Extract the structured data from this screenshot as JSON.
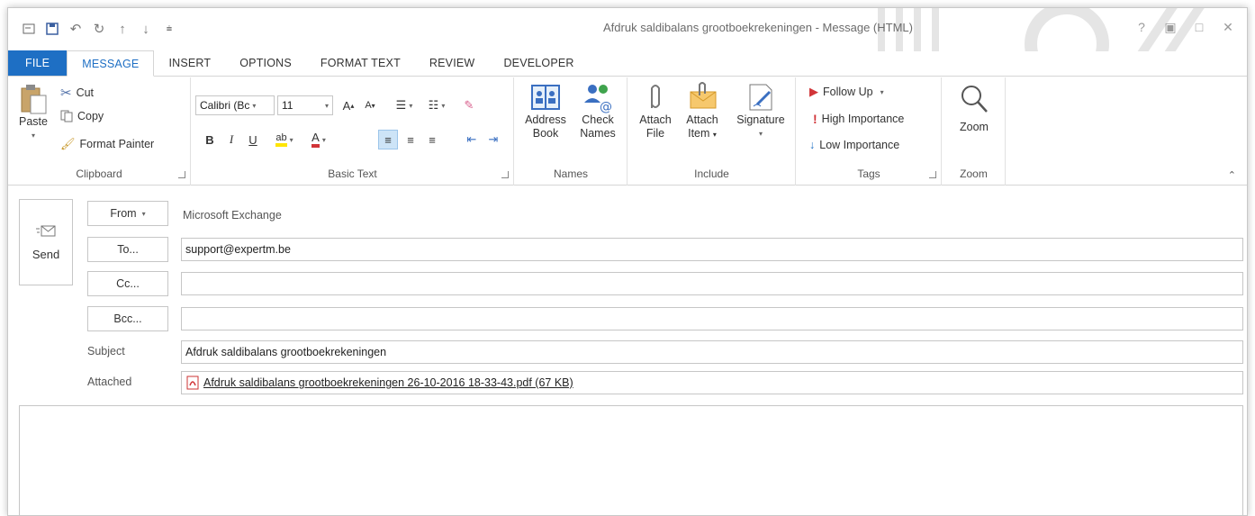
{
  "window": {
    "title": "Afdruk saldibalans grootboekrekeningen - Message (HTML)",
    "controls": [
      "?",
      "▣",
      "□",
      "✕"
    ]
  },
  "qat": {
    "icons": [
      "mail-icon",
      "save-icon",
      "undo-icon",
      "redo-icon",
      "up-arrow-icon",
      "down-arrow-icon",
      "customize-icon"
    ]
  },
  "tabs": [
    "FILE",
    "MESSAGE",
    "INSERT",
    "OPTIONS",
    "FORMAT TEXT",
    "REVIEW",
    "DEVELOPER"
  ],
  "active_tab": "MESSAGE",
  "ribbon": {
    "clipboard": {
      "label": "Clipboard",
      "paste": "Paste",
      "cut": "Cut",
      "copy": "Copy",
      "format_painter": "Format Painter"
    },
    "basic_text": {
      "label": "Basic Text",
      "font_name": "Calibri (Bc",
      "font_size": "11",
      "bold": "B",
      "italic": "I",
      "underline": "U"
    },
    "names": {
      "label": "Names",
      "address_book_1": "Address",
      "address_book_2": "Book",
      "check_names_1": "Check",
      "check_names_2": "Names"
    },
    "include": {
      "label": "Include",
      "attach_file_1": "Attach",
      "attach_file_2": "File",
      "attach_item_1": "Attach",
      "attach_item_2": "Item",
      "signature": "Signature"
    },
    "tags": {
      "label": "Tags",
      "follow_up": "Follow Up",
      "high_importance": "High Importance",
      "low_importance": "Low Importance"
    },
    "zoom": {
      "label": "Zoom",
      "zoom": "Zoom"
    }
  },
  "compose": {
    "send": "Send",
    "from_button": "From",
    "from_value": "Microsoft Exchange",
    "to_button": "To...",
    "to_value": "support@expertm.be",
    "cc_button": "Cc...",
    "cc_value": "",
    "bcc_button": "Bcc...",
    "bcc_value": "",
    "subject_label": "Subject",
    "subject_value": "Afdruk saldibalans grootboekrekeningen",
    "attached_label": "Attached",
    "attachment": "Afdruk saldibalans grootboekrekeningen 26-10-2016 18-33-43.pdf (67 KB)"
  },
  "colors": {
    "accent": "#1e6fc4",
    "flag_red": "#d13438",
    "low_blue": "#1e6fc4"
  }
}
